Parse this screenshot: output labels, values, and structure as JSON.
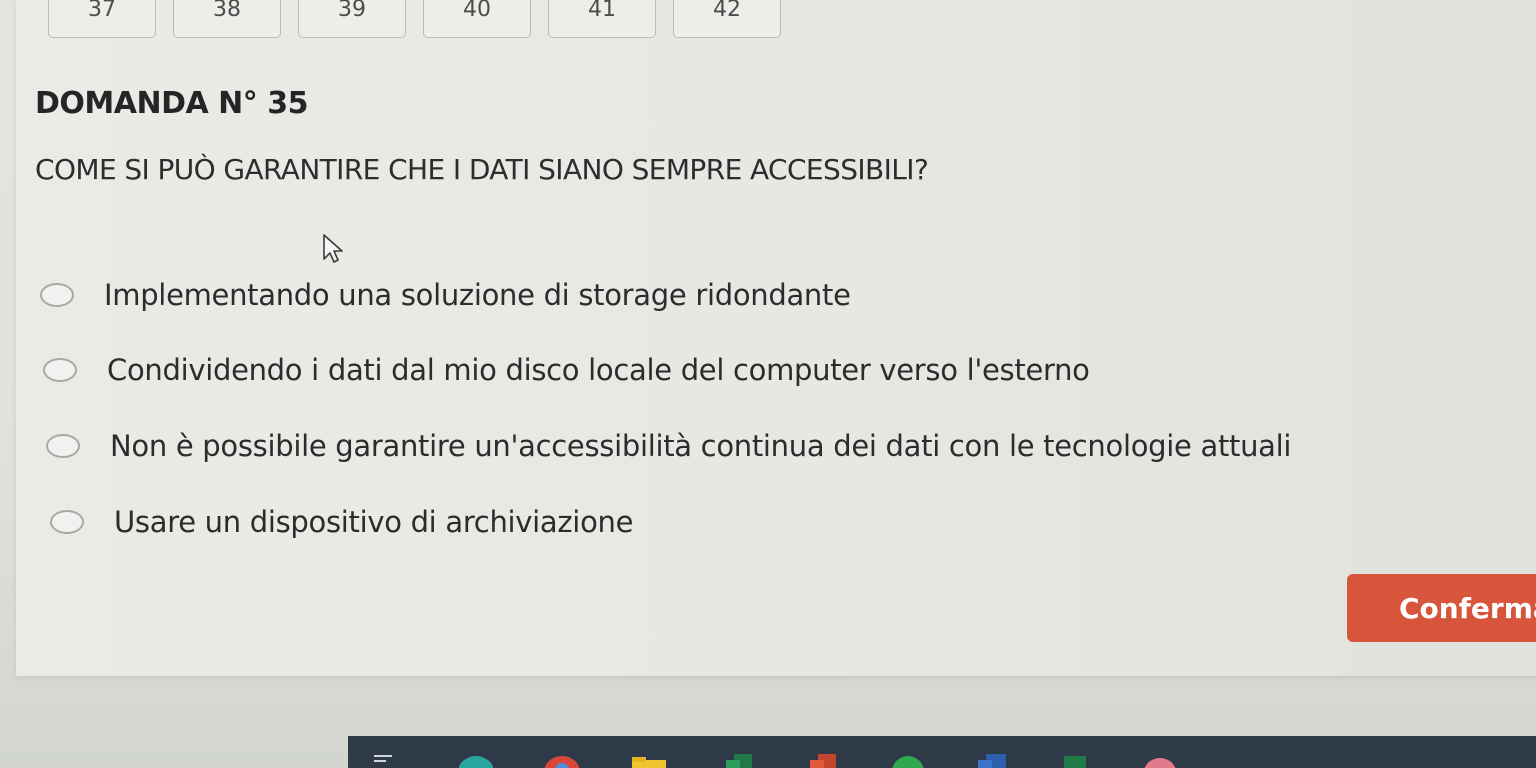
{
  "question_nav": [
    "37",
    "38",
    "39",
    "40",
    "41",
    "42"
  ],
  "question": {
    "number_label": "DOMANDA N° 35",
    "text": "COME SI PUÒ GARANTIRE CHE I DATI SIANO SEMPRE ACCESSIBILI?"
  },
  "options": [
    "Implementando una soluzione di storage ridondante",
    "Condividendo i dati dal mio disco locale del computer verso l'esterno",
    "Non è possibile garantire un'accessibilità continua dei dati con le tecnologie attuali",
    "Usare un dispositivo di archiviazione"
  ],
  "confirm_label": "Conferma",
  "colors": {
    "confirm_button": "#d7553a",
    "taskbar": "#2e3a47"
  },
  "taskbar_icons": [
    "task-view-icon",
    "edge-icon",
    "chrome-icon",
    "file-explorer-icon",
    "excel-icon",
    "powerpoint-icon",
    "green-app-icon",
    "word-icon",
    "pc-app-icon",
    "pink-app-icon"
  ]
}
